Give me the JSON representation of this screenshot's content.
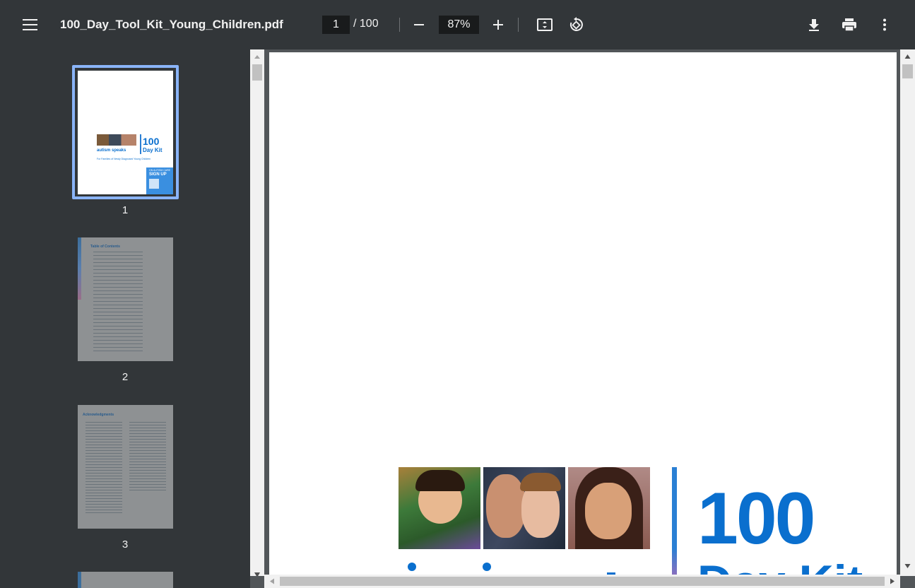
{
  "toolbar": {
    "title": "100_Day_Tool_Kit_Young_Children.pdf",
    "current_page": "1",
    "page_total": "/ 100",
    "zoom": "87%",
    "icons": [
      "menu-icon",
      "zoom-out-icon",
      "zoom-in-icon",
      "fit-page-icon",
      "rotate-icon",
      "download-icon",
      "print-icon",
      "more-vert-icon"
    ]
  },
  "sidebar": {
    "thumbnails": [
      {
        "number": "1"
      },
      {
        "number": "2"
      },
      {
        "number": "3"
      }
    ],
    "thumb1": {
      "brand": "autism speaks",
      "kit_number": "100",
      "kit_label": "Day Kit",
      "subtitle": "For Families of Newly Diagnosed Young Children",
      "signup_top": "ON AUTISM CARE",
      "signup": "SIGN UP"
    },
    "thumb2": {
      "heading": "Table of Contents"
    },
    "thumb3": {
      "heading": "Acknowledgments"
    }
  },
  "document": {
    "kit_number": "100",
    "kit_label": "Day Kit"
  },
  "colors": {
    "toolbar": "#323639",
    "viewer": "#525659",
    "accent": "#8ab4f8",
    "brand_blue": "#0a6fce"
  }
}
